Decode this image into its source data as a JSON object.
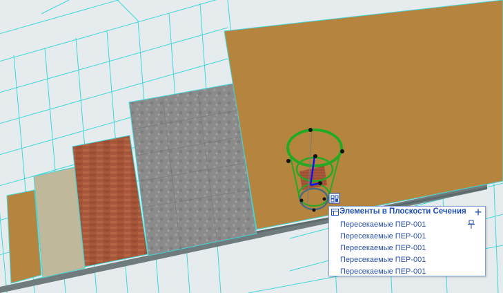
{
  "popup": {
    "title": "Элементы в Плоскости Сечения",
    "add_icon": "plus-icon",
    "pin_icon": "pin-icon",
    "header_icon": "section-plane-icon",
    "items": [
      {
        "label": "Пересекаемые ПЕР-001"
      },
      {
        "label": "Пересекаемые ПЕР-001"
      },
      {
        "label": "Пересекаемые ПЕР-001"
      },
      {
        "label": "Пересекаемые ПЕР-001"
      },
      {
        "label": "Пересекаемые ПЕР-001"
      }
    ]
  },
  "colors": {
    "background": "#e6ecee",
    "grid": "#3fd6d8",
    "wood": "#b5853f",
    "beige": "#c0b89a",
    "brick": "#a8573a",
    "concrete": "#8e8e8e",
    "selection_green": "#22aa22",
    "axis_blue": "#1010ee",
    "accent_blue": "#1f4fb7"
  },
  "viewport": {
    "selection_icon": "element-settings-icon"
  }
}
